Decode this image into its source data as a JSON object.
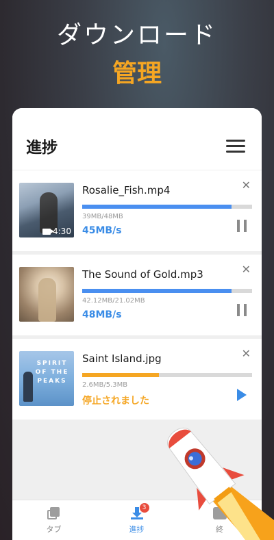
{
  "hero": {
    "title": "ダウンロード",
    "accent": "管理"
  },
  "panel": {
    "title": "進捗",
    "menu_icon": "list-icon"
  },
  "colors": {
    "accent_orange": "#f5a623",
    "accent_blue": "#3a8ce6",
    "progress_blue": "#4a8ff0",
    "progress_orange": "#f5a623"
  },
  "downloads": [
    {
      "file_name": "Rosalie_Fish.mp4",
      "size": "39MB/48MB",
      "speed": "45MB/s",
      "progress": 0.88,
      "duration": "4:30",
      "action_icon": "pause-icon"
    },
    {
      "file_name": "The Sound of Gold.mp3",
      "size": "42.12MB/21.02MB",
      "speed": "48MB/s",
      "progress": 0.88,
      "action_icon": "pause-icon"
    },
    {
      "file_name": "Saint Island.jpg",
      "size": "2.6MB/5.3MB",
      "status": "停止されました",
      "progress": 0.45,
      "action_icon": "play-icon",
      "thumb_text": "SPIRIT OF THE PEAKS"
    }
  ],
  "tabbar": {
    "tabs": [
      {
        "label": "タブ",
        "icon": "tabs-icon"
      },
      {
        "label": "進捗",
        "icon": "download-icon",
        "badge": "3",
        "active": true
      },
      {
        "label": "終",
        "icon": "done-icon"
      }
    ]
  }
}
